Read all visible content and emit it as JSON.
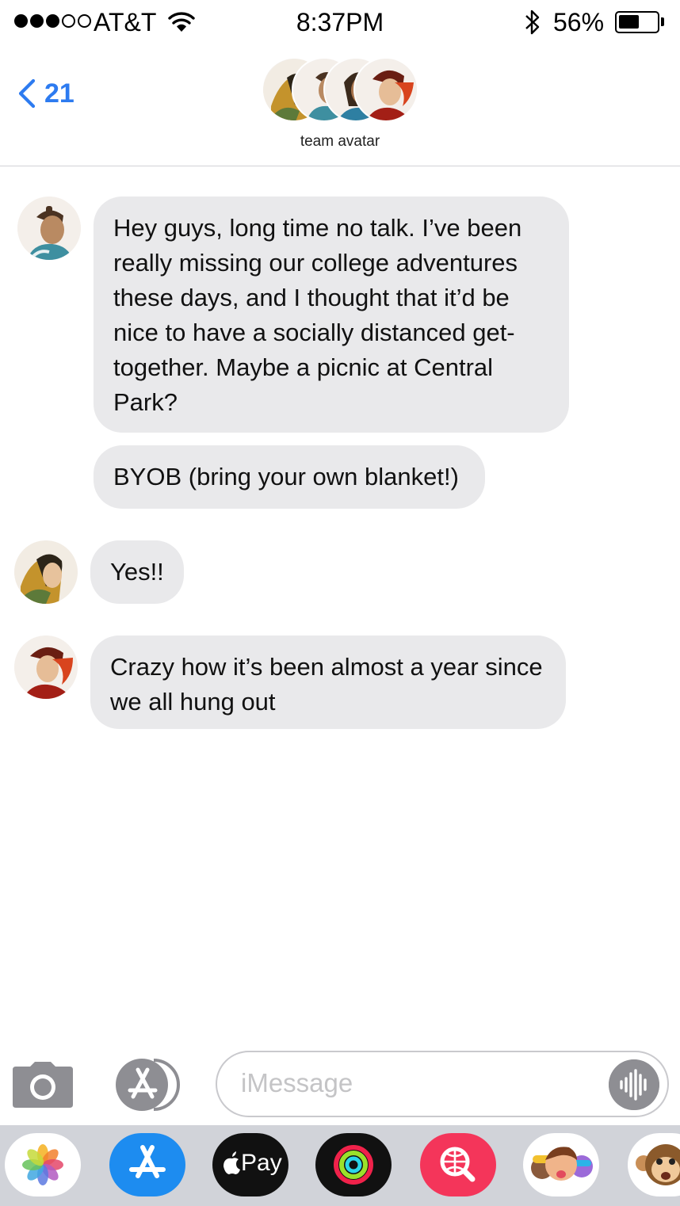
{
  "status_bar": {
    "carrier": "AT&T",
    "time": "8:37PM",
    "battery_percent": "56%",
    "battery_level": 0.56,
    "signal_bars_filled": 3,
    "signal_bars_total": 5
  },
  "header": {
    "back_count": "21",
    "group_name": "team avatar",
    "back_color": "#2d7bf0"
  },
  "messages": [
    {
      "text": "Hey guys, long time no talk. I’ve been really missing our college adventures these days, and I thought that it’d be nice to have a socially distanced get-together. Maybe a picnic at Central Park?"
    },
    {
      "text": "BYOB (bring your own blanket!)"
    },
    {
      "text": "Yes!!"
    },
    {
      "text": "Crazy how it’s been almost a year since we all hung out"
    }
  ],
  "composer": {
    "placeholder": "iMessage"
  },
  "app_drawer": {
    "apple_pay_label": "Pay",
    "apps": [
      "photos-icon",
      "app-store-icon",
      "apple-pay-icon",
      "activity-icon",
      "web-search-icon",
      "memoji-icon",
      "animoji-monkey-icon"
    ]
  }
}
